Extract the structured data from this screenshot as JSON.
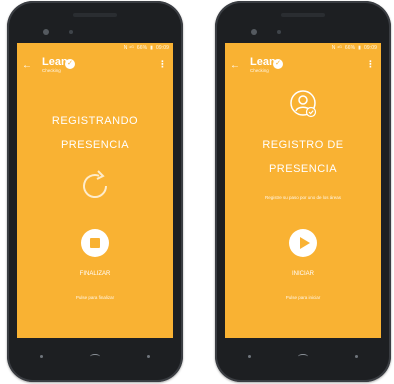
{
  "left_screen": {
    "status": {
      "icons": "N ⁴ᴳ",
      "battery": "66%",
      "time": "09:09"
    },
    "app": {
      "name": "Lean",
      "sub": "Checking"
    },
    "title_line1": "REGISTRANDO",
    "title_line2": "PRESENCIA",
    "action_label": "FINALIZAR",
    "action_hint": "Pulse para finalizar"
  },
  "right_screen": {
    "status": {
      "icons": "N ⁴ᴳ",
      "battery": "66%",
      "time": "09:09"
    },
    "app": {
      "name": "Lean",
      "sub": "Checking"
    },
    "title_line1": "REGISTRO DE",
    "title_line2": "PRESENCIA",
    "hint": "Registre su paso por uno de los áreas",
    "action_label": "INICIAR",
    "action_hint": "Pulse para iniciar"
  },
  "colors": {
    "accent": "#f9b233",
    "phone": "#1d1f22"
  },
  "icons": [
    "back-arrow-icon",
    "verified-check-icon",
    "overflow-menu-icon",
    "refresh-icon",
    "stop-icon",
    "user-check-icon",
    "play-icon"
  ]
}
